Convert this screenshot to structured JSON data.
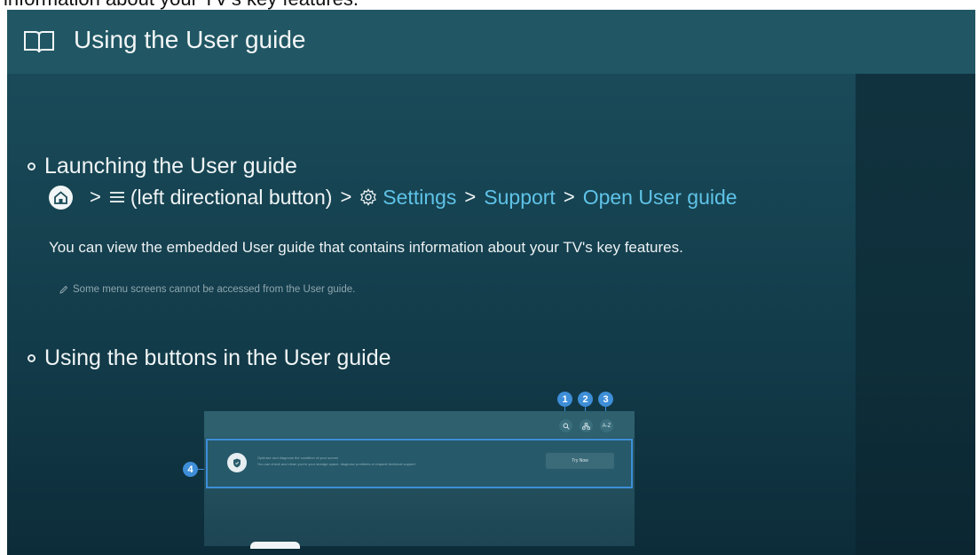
{
  "caption": "information about your TV's key features.",
  "header": {
    "title": "Using the User guide",
    "icon": "book-icon"
  },
  "section1": {
    "title": "Launching the User guide",
    "path": {
      "home_icon": "home-icon",
      "menu_icon": "menu-icon",
      "menu_label": "(left directional button)",
      "settings_label": "Settings",
      "support_label": "Support",
      "open_label": "Open User guide",
      "separator": ">"
    },
    "description": "You can view the embedded User guide that contains information about your TV's key features.",
    "note": "Some menu screens cannot be accessed from the User guide."
  },
  "section2": {
    "title": "Using the buttons in the User guide",
    "badges": [
      "1",
      "2",
      "3",
      "4"
    ],
    "mini": {
      "search_icon": "search-icon",
      "category_icon": "category-icon",
      "az_label": "A-Z",
      "line1": "Optimize and diagnose the condition of your screen",
      "line2": "You can check and clean you're your storage space, diagnose problems or request technical support",
      "try_now": "Try Now"
    }
  },
  "colors": {
    "accent_link": "#5fc3e8",
    "badge": "#3e8ed8",
    "header_bg": "#215764"
  }
}
